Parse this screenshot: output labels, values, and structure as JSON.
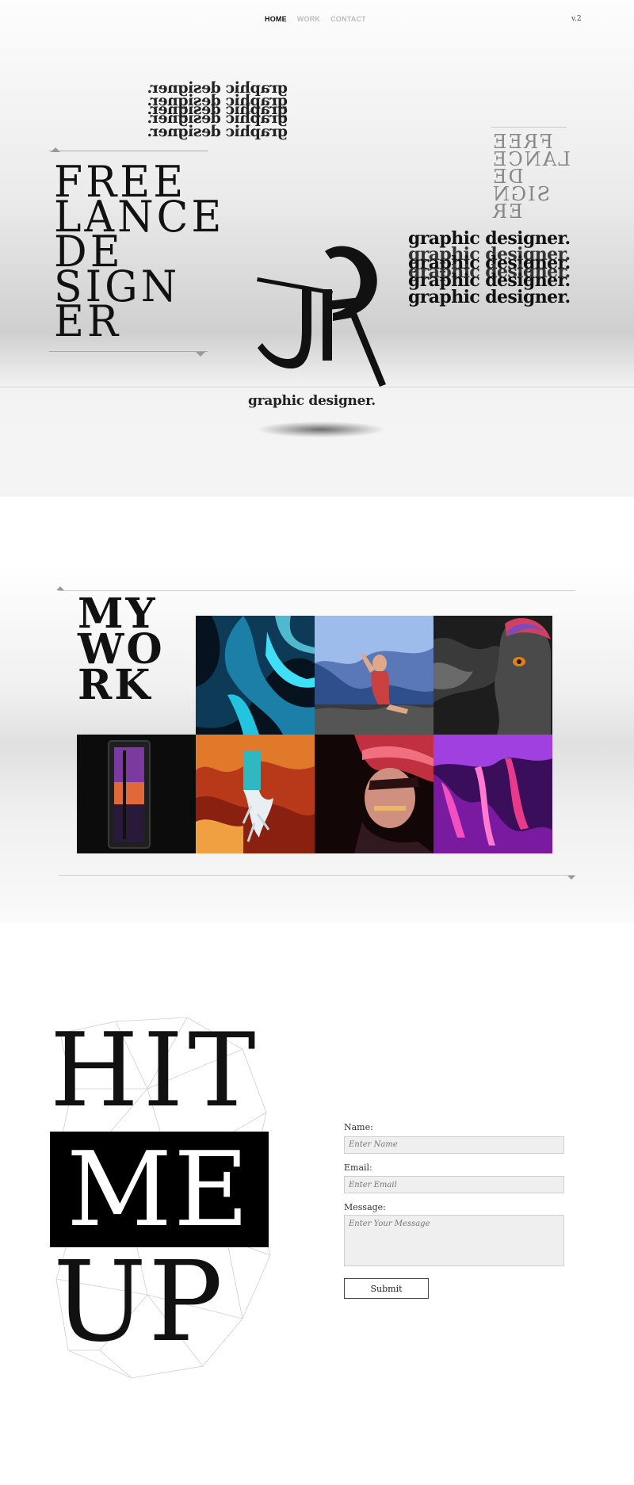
{
  "nav": {
    "links": [
      {
        "label": "HOME",
        "active": true
      },
      {
        "label": "WORK",
        "active": false
      },
      {
        "label": "CONTACT",
        "active": false
      }
    ],
    "version": "v.2"
  },
  "hero": {
    "mirrored_tagline": "graphic designer.",
    "title_lines": [
      "FREE",
      "LANCE",
      "DE",
      "SIGN",
      "ER"
    ],
    "mirrored_title_lines": [
      "FREE",
      "LANCE",
      "DE",
      "SIGN",
      "ER"
    ],
    "tagline_stack": "graphic designer.",
    "logo_caption": "graphic designer."
  },
  "work": {
    "title_lines": [
      "MY",
      "WO",
      "RK"
    ],
    "tiles": [
      {
        "name": "cyan-abstract-artwork",
        "palette": [
          "#0a2f47",
          "#25c7e6"
        ]
      },
      {
        "name": "blue-surreal-figure-artwork",
        "palette": [
          "#3a5a9a",
          "#9ec2f5"
        ]
      },
      {
        "name": "marbled-bust-artwork",
        "palette": [
          "#2a2a2a",
          "#d64a4a"
        ]
      },
      {
        "name": "dark-door-sunset-artwork",
        "palette": [
          "#111111",
          "#e0683a"
        ]
      },
      {
        "name": "orange-coral-artwork",
        "palette": [
          "#c2401a",
          "#f09a38"
        ]
      },
      {
        "name": "glitch-portrait-artwork",
        "palette": [
          "#1a0a0a",
          "#e8506a"
        ]
      },
      {
        "name": "violet-liquid-artwork",
        "palette": [
          "#6a1a9a",
          "#e44ac8"
        ]
      }
    ]
  },
  "contact": {
    "heading_lines": [
      "HIT",
      "ME",
      "UP"
    ],
    "form": {
      "name_label": "Name:",
      "name_placeholder": "Enter Name",
      "email_label": "Email:",
      "email_placeholder": "Enter Email",
      "message_label": "Message:",
      "message_placeholder": "Enter Your Message",
      "submit_label": "Submit"
    }
  }
}
